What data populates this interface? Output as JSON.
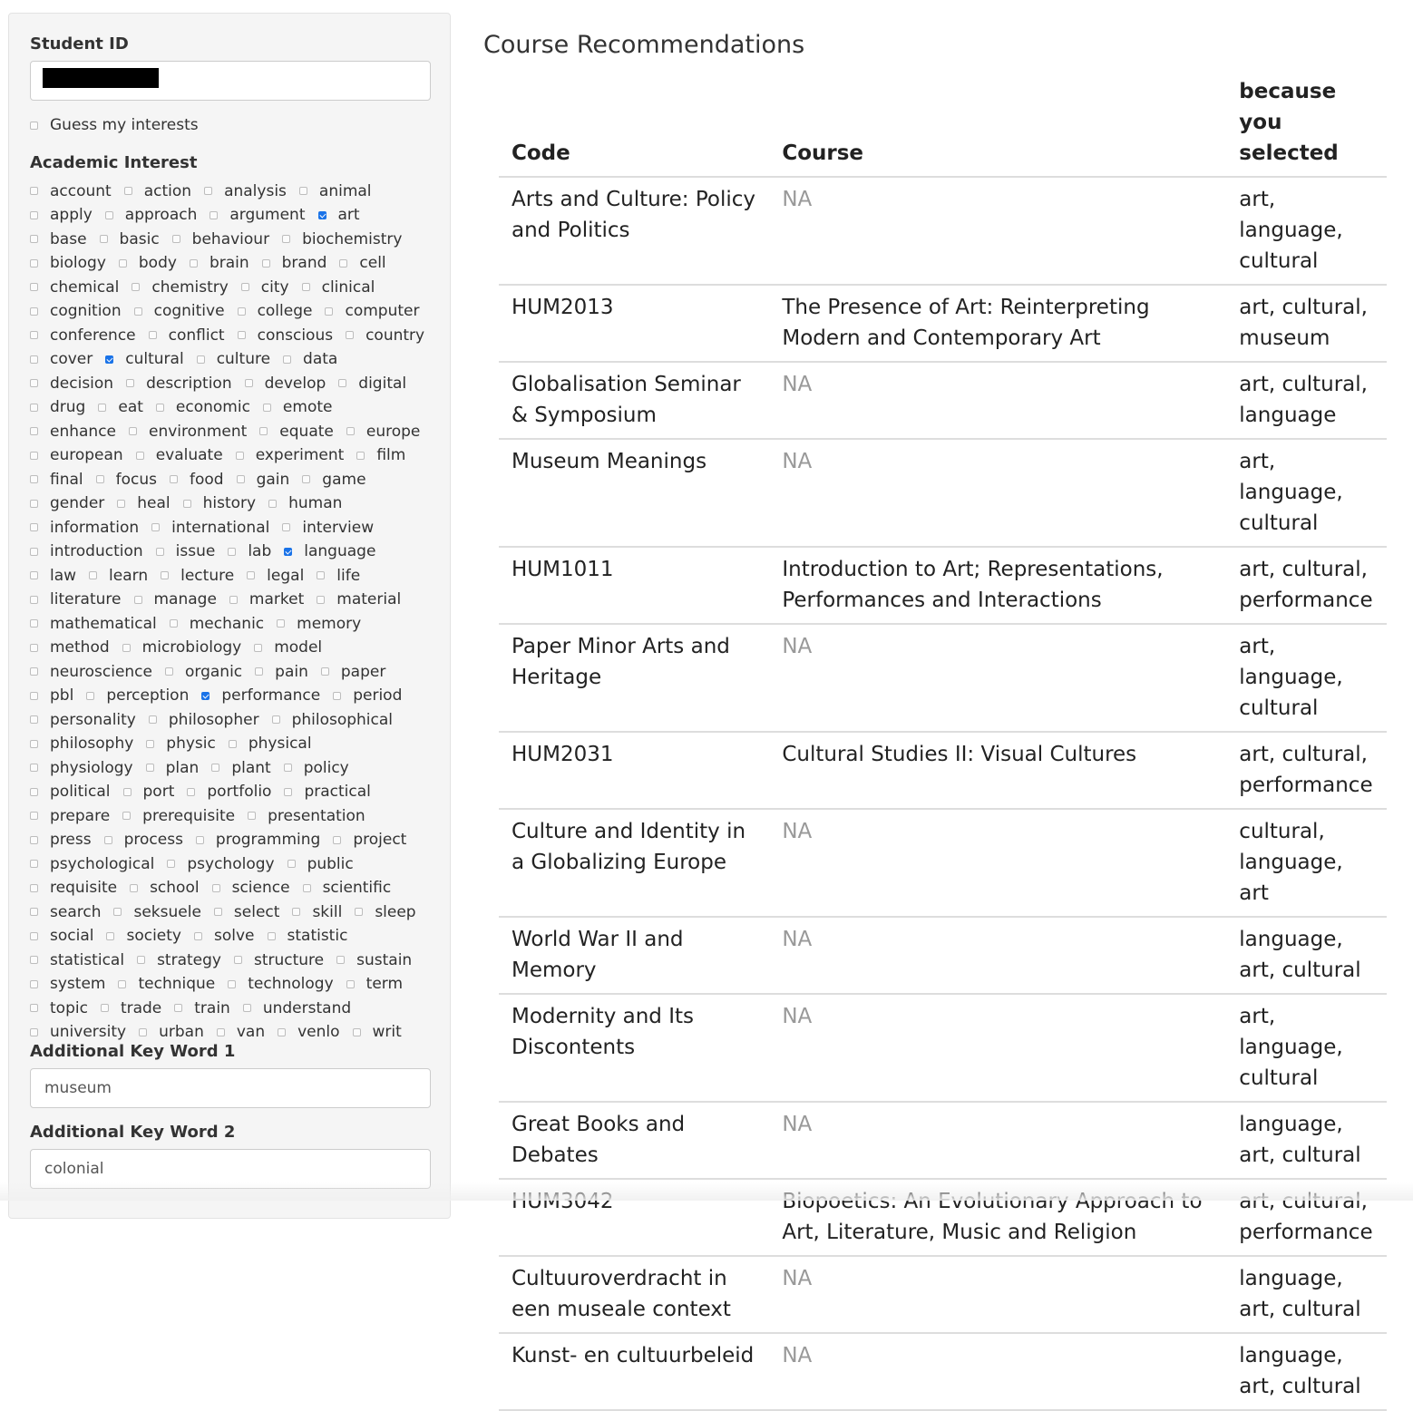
{
  "sidebar": {
    "student_id_label": "Student ID",
    "student_id_value": "",
    "guess_label": "Guess my interests",
    "guess_checked": false,
    "interest_label": "Academic Interest",
    "interests": [
      {
        "label": "account",
        "checked": false
      },
      {
        "label": "action",
        "checked": false
      },
      {
        "label": "analysis",
        "checked": false
      },
      {
        "label": "animal",
        "checked": false
      },
      {
        "label": "apply",
        "checked": false
      },
      {
        "label": "approach",
        "checked": false
      },
      {
        "label": "argument",
        "checked": false
      },
      {
        "label": "art",
        "checked": true
      },
      {
        "label": "base",
        "checked": false
      },
      {
        "label": "basic",
        "checked": false
      },
      {
        "label": "behaviour",
        "checked": false
      },
      {
        "label": "biochemistry",
        "checked": false
      },
      {
        "label": "biology",
        "checked": false
      },
      {
        "label": "body",
        "checked": false
      },
      {
        "label": "brain",
        "checked": false
      },
      {
        "label": "brand",
        "checked": false
      },
      {
        "label": "cell",
        "checked": false
      },
      {
        "label": "chemical",
        "checked": false
      },
      {
        "label": "chemistry",
        "checked": false
      },
      {
        "label": "city",
        "checked": false
      },
      {
        "label": "clinical",
        "checked": false
      },
      {
        "label": "cognition",
        "checked": false
      },
      {
        "label": "cognitive",
        "checked": false
      },
      {
        "label": "college",
        "checked": false
      },
      {
        "label": "computer",
        "checked": false
      },
      {
        "label": "conference",
        "checked": false
      },
      {
        "label": "conflict",
        "checked": false
      },
      {
        "label": "conscious",
        "checked": false
      },
      {
        "label": "country",
        "checked": false
      },
      {
        "label": "cover",
        "checked": false
      },
      {
        "label": "cultural",
        "checked": true
      },
      {
        "label": "culture",
        "checked": false
      },
      {
        "label": "data",
        "checked": false
      },
      {
        "label": "decision",
        "checked": false
      },
      {
        "label": "description",
        "checked": false
      },
      {
        "label": "develop",
        "checked": false
      },
      {
        "label": "digital",
        "checked": false
      },
      {
        "label": "drug",
        "checked": false
      },
      {
        "label": "eat",
        "checked": false
      },
      {
        "label": "economic",
        "checked": false
      },
      {
        "label": "emote",
        "checked": false
      },
      {
        "label": "enhance",
        "checked": false
      },
      {
        "label": "environment",
        "checked": false
      },
      {
        "label": "equate",
        "checked": false
      },
      {
        "label": "europe",
        "checked": false
      },
      {
        "label": "european",
        "checked": false
      },
      {
        "label": "evaluate",
        "checked": false
      },
      {
        "label": "experiment",
        "checked": false
      },
      {
        "label": "film",
        "checked": false
      },
      {
        "label": "final",
        "checked": false
      },
      {
        "label": "focus",
        "checked": false
      },
      {
        "label": "food",
        "checked": false
      },
      {
        "label": "gain",
        "checked": false
      },
      {
        "label": "game",
        "checked": false
      },
      {
        "label": "gender",
        "checked": false
      },
      {
        "label": "heal",
        "checked": false
      },
      {
        "label": "history",
        "checked": false
      },
      {
        "label": "human",
        "checked": false
      },
      {
        "label": "information",
        "checked": false
      },
      {
        "label": "international",
        "checked": false
      },
      {
        "label": "interview",
        "checked": false
      },
      {
        "label": "introduction",
        "checked": false
      },
      {
        "label": "issue",
        "checked": false
      },
      {
        "label": "lab",
        "checked": false
      },
      {
        "label": "language",
        "checked": true
      },
      {
        "label": "law",
        "checked": false
      },
      {
        "label": "learn",
        "checked": false
      },
      {
        "label": "lecture",
        "checked": false
      },
      {
        "label": "legal",
        "checked": false
      },
      {
        "label": "life",
        "checked": false
      },
      {
        "label": "literature",
        "checked": false
      },
      {
        "label": "manage",
        "checked": false
      },
      {
        "label": "market",
        "checked": false
      },
      {
        "label": "material",
        "checked": false
      },
      {
        "label": "mathematical",
        "checked": false
      },
      {
        "label": "mechanic",
        "checked": false
      },
      {
        "label": "memory",
        "checked": false
      },
      {
        "label": "method",
        "checked": false
      },
      {
        "label": "microbiology",
        "checked": false
      },
      {
        "label": "model",
        "checked": false
      },
      {
        "label": "neuroscience",
        "checked": false
      },
      {
        "label": "organic",
        "checked": false
      },
      {
        "label": "pain",
        "checked": false
      },
      {
        "label": "paper",
        "checked": false
      },
      {
        "label": "pbl",
        "checked": false
      },
      {
        "label": "perception",
        "checked": false
      },
      {
        "label": "performance",
        "checked": true
      },
      {
        "label": "period",
        "checked": false
      },
      {
        "label": "personality",
        "checked": false
      },
      {
        "label": "philosopher",
        "checked": false
      },
      {
        "label": "philosophical",
        "checked": false
      },
      {
        "label": "philosophy",
        "checked": false
      },
      {
        "label": "physic",
        "checked": false
      },
      {
        "label": "physical",
        "checked": false
      },
      {
        "label": "physiology",
        "checked": false
      },
      {
        "label": "plan",
        "checked": false
      },
      {
        "label": "plant",
        "checked": false
      },
      {
        "label": "policy",
        "checked": false
      },
      {
        "label": "political",
        "checked": false
      },
      {
        "label": "port",
        "checked": false
      },
      {
        "label": "portfolio",
        "checked": false
      },
      {
        "label": "practical",
        "checked": false
      },
      {
        "label": "prepare",
        "checked": false
      },
      {
        "label": "prerequisite",
        "checked": false
      },
      {
        "label": "presentation",
        "checked": false
      },
      {
        "label": "press",
        "checked": false
      },
      {
        "label": "process",
        "checked": false
      },
      {
        "label": "programming",
        "checked": false
      },
      {
        "label": "project",
        "checked": false
      },
      {
        "label": "psychological",
        "checked": false
      },
      {
        "label": "psychology",
        "checked": false
      },
      {
        "label": "public",
        "checked": false
      },
      {
        "label": "requisite",
        "checked": false
      },
      {
        "label": "school",
        "checked": false
      },
      {
        "label": "science",
        "checked": false
      },
      {
        "label": "scientific",
        "checked": false
      },
      {
        "label": "search",
        "checked": false
      },
      {
        "label": "seksuele",
        "checked": false
      },
      {
        "label": "select",
        "checked": false
      },
      {
        "label": "skill",
        "checked": false
      },
      {
        "label": "sleep",
        "checked": false
      },
      {
        "label": "social",
        "checked": false
      },
      {
        "label": "society",
        "checked": false
      },
      {
        "label": "solve",
        "checked": false
      },
      {
        "label": "statistic",
        "checked": false
      },
      {
        "label": "statistical",
        "checked": false
      },
      {
        "label": "strategy",
        "checked": false
      },
      {
        "label": "structure",
        "checked": false
      },
      {
        "label": "sustain",
        "checked": false
      },
      {
        "label": "system",
        "checked": false
      },
      {
        "label": "technique",
        "checked": false
      },
      {
        "label": "technology",
        "checked": false
      },
      {
        "label": "term",
        "checked": false
      },
      {
        "label": "topic",
        "checked": false
      },
      {
        "label": "trade",
        "checked": false
      },
      {
        "label": "train",
        "checked": false
      },
      {
        "label": "understand",
        "checked": false
      },
      {
        "label": "university",
        "checked": false
      },
      {
        "label": "urban",
        "checked": false
      },
      {
        "label": "van",
        "checked": false
      },
      {
        "label": "venlo",
        "checked": false
      },
      {
        "label": "writ",
        "checked": false
      }
    ],
    "keyword1_label": "Additional Key Word 1",
    "keyword1_value": "museum",
    "keyword2_label": "Additional Key Word 2",
    "keyword2_value": "colonial"
  },
  "main": {
    "title": "Course Recommendations",
    "columns": [
      "Code",
      "Course",
      "because you selected"
    ],
    "rows": [
      {
        "code": "Arts and Culture: Policy and Politics",
        "course": "NA",
        "because": "art, language, cultural"
      },
      {
        "code": "HUM2013",
        "course": "The Presence of Art: Reinterpreting Modern and Contemporary Art",
        "because": "art, cultural, museum"
      },
      {
        "code": "Globalisation Seminar & Symposium",
        "course": "NA",
        "because": "art, cultural, language"
      },
      {
        "code": "Museum Meanings",
        "course": "NA",
        "because": "art, language, cultural"
      },
      {
        "code": "HUM1011",
        "course": "Introduction to Art; Representations, Performances and Interactions",
        "because": "art, cultural, performance"
      },
      {
        "code": "Paper Minor Arts and Heritage",
        "course": "NA",
        "because": "art, language, cultural"
      },
      {
        "code": "HUM2031",
        "course": "Cultural Studies II: Visual Cultures",
        "because": "art, cultural, performance"
      },
      {
        "code": "Culture and Identity in a Globalizing Europe",
        "course": "NA",
        "because": "cultural, language, art"
      },
      {
        "code": "World War II and Memory",
        "course": "NA",
        "because": "language, art, cultural"
      },
      {
        "code": "Modernity and Its Discontents",
        "course": "NA",
        "because": "art, language, cultural"
      },
      {
        "code": "Great Books and Debates",
        "course": "NA",
        "because": "language, art, cultural"
      },
      {
        "code": "HUM3042",
        "course": "Biopoetics: An Evolutionary Approach to Art, Literature, Music and Religion",
        "because": "art, cultural, performance"
      },
      {
        "code": "Cultuuroverdracht in een museale context",
        "course": "NA",
        "because": "language, art, cultural"
      },
      {
        "code": "Kunst- en cultuurbeleid",
        "course": "NA",
        "because": "language, art, cultural"
      }
    ]
  }
}
